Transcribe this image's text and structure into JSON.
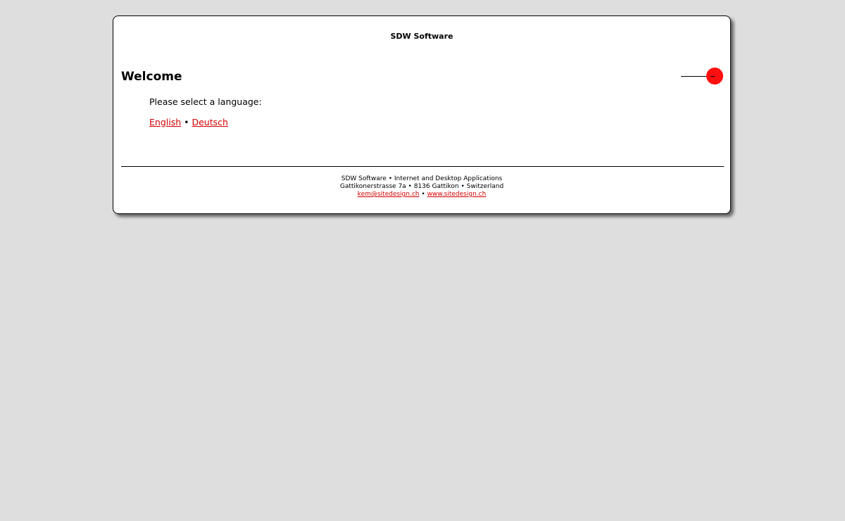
{
  "header": {
    "site_title": "SDW Software"
  },
  "main": {
    "heading": "Welcome",
    "prompt": "Please select a language:",
    "languages": [
      {
        "label": "English"
      },
      {
        "label": "Deutsch"
      }
    ],
    "separator": "•"
  },
  "footer": {
    "line1": "SDW Software • Internet and Desktop Applications",
    "line2": "Gattikonerstrasse 7a • 8136 Gattikon • Switzerland",
    "email": "kem@sitedesign.ch",
    "separator": "•",
    "website": "www.sitedesign.ch"
  },
  "colors": {
    "background": "#dedede",
    "link": "#d40000",
    "accent_dot": "#ff1010"
  }
}
